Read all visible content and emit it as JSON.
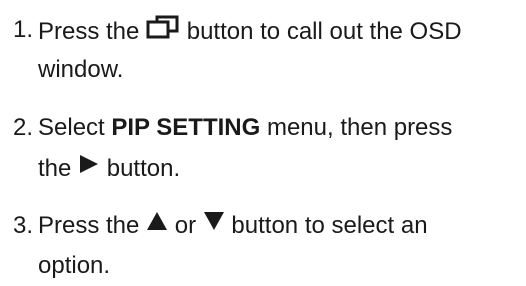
{
  "steps": [
    {
      "number": "1.",
      "pre": "Press the",
      "icon": "pip-window-icon",
      "post": "button to call out the OSD",
      "line2": "window."
    },
    {
      "number": "2.",
      "pre": "Select",
      "bold": "PIP SETTING",
      "post": "menu, then press",
      "line2_pre": "the",
      "icon": "right-triangle-icon",
      "line2_post": "button."
    },
    {
      "number": "3.",
      "pre": "Press the",
      "icon_up": "up-triangle-icon",
      "mid": "or",
      "icon_down": "down-triangle-icon",
      "post": "button to select an",
      "line2": "option."
    }
  ]
}
